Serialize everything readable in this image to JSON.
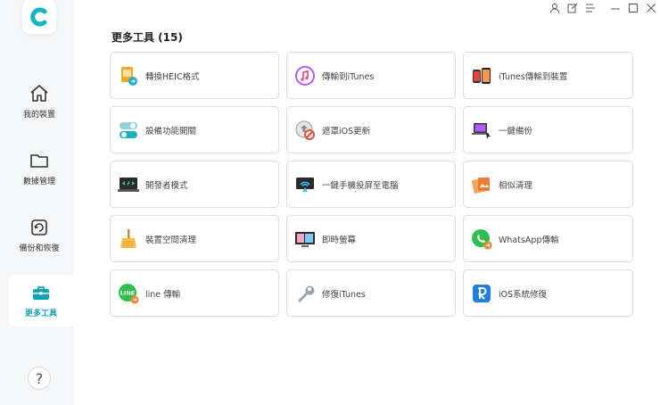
{
  "sidebar": {
    "items": [
      {
        "label": "我的裝置",
        "icon": "home-icon"
      },
      {
        "label": "數據管理",
        "icon": "folder-icon"
      },
      {
        "label": "備份和恢復",
        "icon": "backup-icon"
      },
      {
        "label": "更多工具",
        "icon": "toolbox-icon",
        "active": true
      }
    ],
    "help_label": "?"
  },
  "main": {
    "title": "更多工具 (15)",
    "tools": [
      {
        "label": "轉換HEIC格式",
        "icon": "heic-convert-icon"
      },
      {
        "label": "傳輸到iTunes",
        "icon": "music-transfer-icon"
      },
      {
        "label": "iTunes傳輸到裝置",
        "icon": "itunes-to-device-icon"
      },
      {
        "label": "設備功能開關",
        "icon": "toggle-switch-icon"
      },
      {
        "label": "遮罩iOS更新",
        "icon": "block-update-icon"
      },
      {
        "label": "一鍵備份",
        "icon": "laptop-backup-icon"
      },
      {
        "label": "開發者模式",
        "icon": "developer-mode-icon"
      },
      {
        "label": "一鍵手機投屏至電腦",
        "icon": "screen-cast-icon"
      },
      {
        "label": "相似清理",
        "icon": "photo-cleanup-icon"
      },
      {
        "label": "裝置空間清理",
        "icon": "broom-icon"
      },
      {
        "label": "即時螢幕",
        "icon": "live-screen-icon"
      },
      {
        "label": "WhatsApp傳輸",
        "icon": "whatsapp-icon"
      },
      {
        "label": "line 傳輸",
        "icon": "line-icon"
      },
      {
        "label": "修復iTunes",
        "icon": "wrench-icon"
      },
      {
        "label": "iOS系統修復",
        "icon": "ios-repair-icon"
      }
    ]
  },
  "colors": {
    "accent": "#0fa3b1",
    "sidebar_bg": "#f5f6f7",
    "card_border": "#dcdcdc"
  }
}
